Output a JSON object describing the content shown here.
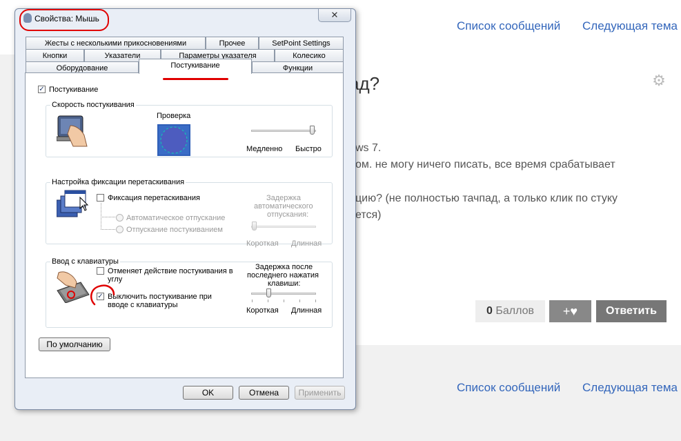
{
  "background_page": {
    "nav_top": {
      "messages": "Список сообщений",
      "next_topic": "Следующая тема"
    },
    "nav_bottom": {
      "messages": "Список сообщений",
      "next_topic": "Следующая тема"
    },
    "post_title": "ад?",
    "post_lines": [
      "ws 7.",
      "ом. не могу ничего писать, все время срабатывает",
      "цию? (не полностью тачпад, а только клик по стуку",
      "ется)"
    ],
    "score_value": "0",
    "score_label": "Баллов",
    "like_label": "+♥",
    "reply_label": "Ответить"
  },
  "dialog": {
    "title": "Свойства: Мышь",
    "close_label": "✕",
    "tabs_row1": [
      "Жесты с несколькими прикосновениями",
      "Прочее",
      "SetPoint Settings"
    ],
    "tabs_row2": [
      "Кнопки",
      "Указатели",
      "Параметры указателя",
      "Колесико"
    ],
    "tabs_row3": [
      "Оборудование",
      "Постукивание",
      "Функции"
    ],
    "active_tab": "Постукивание",
    "tapping": {
      "enable_label": "Постукивание",
      "enable_checked": true,
      "speed_group": {
        "title": "Скорость постукивания",
        "test_label": "Проверка",
        "slow_label": "Медленно",
        "fast_label": "Быстро",
        "speed_level": 1.0
      },
      "drag_group": {
        "title": "Настройка фиксации перетаскивания",
        "drag_lock_label": "Фиксация перетаскивания",
        "drag_lock_checked": false,
        "auto_release_label": "Автоматическое отпускание",
        "tap_release_label": "Отпускание постукиванием",
        "delay_label_1": "Задержка",
        "delay_label_2": "автоматического",
        "delay_label_3": "отпускания:",
        "short_label": "Короткая",
        "long_label": "Длинная",
        "delay_level": 0.0
      },
      "keyboard_group": {
        "title": "Ввод с клавиатуры",
        "cancel_corner_label_1": "Отменяет действие постукивания в",
        "cancel_corner_label_2": "углу",
        "cancel_corner_checked": false,
        "disable_typing_label_1": "Выключить постукивание при",
        "disable_typing_label_2": "вводе с клавиатуры",
        "disable_typing_checked": true,
        "delay_label_1": "Задержка после",
        "delay_label_2": "последнего нажатия",
        "delay_label_3": "клавиши:",
        "short_label": "Короткая",
        "long_label": "Длинная",
        "delay_level": 0.25
      },
      "defaults_label": "По умолчанию"
    },
    "ok_label": "OK",
    "cancel_label": "Отмена",
    "apply_label": "Применить"
  },
  "colors": {
    "annotation": "#e00000",
    "link": "#3366bb"
  }
}
